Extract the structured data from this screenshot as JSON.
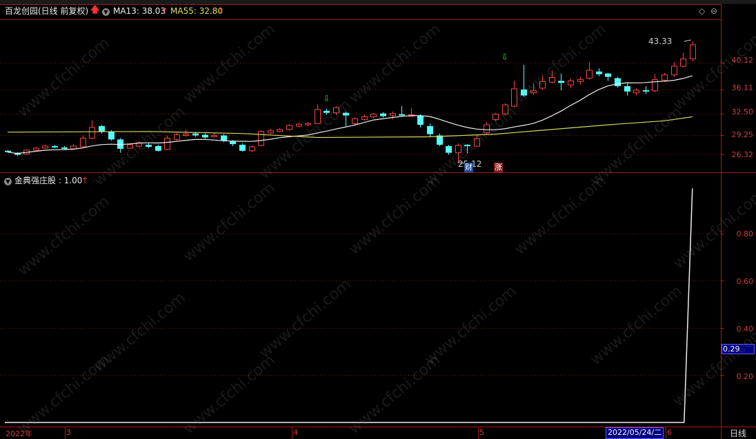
{
  "top_menu": [],
  "top_right_menu": [
    "",
    "",
    "",
    "",
    "",
    ""
  ],
  "price_panel": {
    "title": "百龙创园(日线 前复权)",
    "ma13_label": "MA13: 38.03",
    "ma55_label": "MA55: 32.80",
    "arrow": "↑",
    "high_label": "43.33",
    "low_label": "25.12",
    "marker_cai": "财",
    "marker_zhang": "涨",
    "y_ticks": [
      "40.12",
      "36.11",
      "32.50",
      "29.25",
      "26.32"
    ]
  },
  "indicator_panel": {
    "title": "金典强庄股 : 1.00",
    "arrow": "↑",
    "y_ticks": [
      "0.80",
      "0.60",
      "0.40",
      "0.20"
    ],
    "current_value": "0.29",
    "values_note": "flat 0 then spike to ~0.99 on last bar"
  },
  "date_axis": {
    "labels": [
      "2022年",
      "3",
      "4",
      "5",
      "6"
    ],
    "highlight": "2022/05/24/二",
    "period": "日线"
  },
  "watermark": "www.cfchi.com",
  "colors": {
    "up": "#ff4444",
    "down": "#54ffff",
    "ma13": "#f0f0f0",
    "ma55": "#d8d860",
    "grid": "#7a1a1a",
    "axis": "#a01c1c"
  },
  "candles": [
    [
      26.9,
      26.7,
      27.0,
      26.6
    ],
    [
      26.6,
      26.3,
      26.7,
      26.1
    ],
    [
      26.4,
      27.0,
      27.1,
      26.3
    ],
    [
      27.0,
      27.3,
      27.5,
      26.9
    ],
    [
      27.3,
      27.6,
      27.8,
      27.2
    ],
    [
      27.6,
      27.4,
      27.8,
      27.3
    ],
    [
      27.4,
      27.2,
      27.6,
      27.1
    ],
    [
      27.2,
      27.6,
      27.9,
      27.1
    ],
    [
      27.5,
      28.8,
      29.2,
      27.4
    ],
    [
      28.8,
      30.4,
      31.5,
      28.6
    ],
    [
      30.6,
      29.8,
      30.8,
      29.5
    ],
    [
      29.8,
      28.6,
      30.0,
      28.4
    ],
    [
      28.6,
      27.2,
      28.8,
      26.6
    ],
    [
      27.3,
      27.8,
      28.0,
      27.2
    ],
    [
      27.6,
      28.1,
      28.3,
      27.4
    ],
    [
      27.8,
      27.5,
      28.0,
      27.3
    ],
    [
      27.6,
      26.9,
      27.8,
      26.8
    ],
    [
      27.1,
      28.8,
      29.2,
      27.0
    ],
    [
      28.6,
      29.3,
      29.6,
      28.4
    ],
    [
      29.2,
      29.4,
      30.1,
      29.0
    ],
    [
      29.5,
      29.2,
      29.7,
      29.0
    ],
    [
      29.3,
      28.9,
      29.5,
      28.7
    ],
    [
      29.0,
      29.2,
      29.5,
      28.9
    ],
    [
      29.2,
      28.4,
      29.4,
      28.2
    ],
    [
      28.3,
      27.9,
      28.5,
      27.6
    ],
    [
      27.8,
      26.9,
      28.0,
      26.8
    ],
    [
      26.9,
      27.5,
      27.7,
      26.7
    ],
    [
      27.7,
      29.8,
      30.0,
      27.6
    ],
    [
      29.6,
      29.9,
      30.2,
      29.4
    ],
    [
      29.8,
      30.1,
      30.3,
      29.7
    ],
    [
      30.1,
      30.7,
      30.9,
      29.9
    ],
    [
      30.6,
      30.9,
      31.1,
      30.4
    ],
    [
      30.8,
      31.0,
      31.2,
      30.6
    ],
    [
      31.0,
      33.1,
      33.9,
      30.9
    ],
    [
      32.9,
      32.6,
      33.2,
      32.3
    ],
    [
      32.6,
      33.4,
      33.6,
      32.3
    ],
    [
      32.6,
      32.2,
      32.8,
      30.6
    ],
    [
      31.0,
      31.7,
      31.9,
      30.8
    ],
    [
      31.6,
      32.0,
      32.3,
      31.4
    ],
    [
      32.0,
      32.4,
      32.6,
      31.8
    ],
    [
      32.5,
      32.1,
      32.7,
      31.9
    ],
    [
      32.2,
      32.5,
      32.8,
      31.6
    ],
    [
      32.4,
      32.2,
      33.6,
      32.1
    ],
    [
      32.1,
      32.3,
      33.3,
      32.0
    ],
    [
      32.2,
      30.8,
      32.4,
      30.4
    ],
    [
      30.6,
      29.4,
      31.0,
      29.0
    ],
    [
      29.2,
      27.8,
      29.5,
      27.6
    ],
    [
      27.6,
      26.6,
      27.8,
      26.3
    ],
    [
      26.6,
      27.7,
      28.0,
      25.12
    ],
    [
      27.8,
      27.6,
      27.9,
      26.5
    ],
    [
      27.6,
      28.7,
      29.2,
      27.5
    ],
    [
      29.6,
      30.8,
      31.2,
      29.4
    ],
    [
      31.6,
      32.4,
      32.6,
      31.3
    ],
    [
      32.4,
      33.8,
      34.0,
      32.2
    ],
    [
      33.6,
      36.2,
      37.4,
      33.4
    ],
    [
      36.1,
      35.2,
      39.8,
      35.0
    ],
    [
      35.6,
      35.9,
      37.0,
      35.3
    ],
    [
      36.3,
      37.3,
      38.2,
      36.0
    ],
    [
      37.2,
      37.9,
      39.0,
      37.0
    ],
    [
      37.4,
      37.1,
      38.5,
      36.0
    ],
    [
      36.8,
      37.4,
      37.8,
      36.3
    ],
    [
      37.3,
      37.6,
      38.0,
      36.8
    ],
    [
      37.8,
      39.0,
      40.2,
      37.6
    ],
    [
      38.8,
      38.4,
      39.3,
      38.1
    ],
    [
      38.5,
      38.0,
      38.6,
      37.4
    ],
    [
      37.8,
      36.6,
      38.0,
      36.4
    ],
    [
      36.6,
      35.8,
      37.0,
      35.2
    ],
    [
      35.6,
      36.0,
      36.3,
      35.2
    ],
    [
      36.0,
      35.8,
      36.6,
      35.4
    ],
    [
      35.9,
      37.6,
      38.4,
      35.7
    ],
    [
      37.5,
      38.3,
      38.6,
      37.2
    ],
    [
      38.3,
      39.6,
      40.2,
      38.0
    ],
    [
      39.6,
      40.7,
      41.6,
      39.4
    ],
    [
      40.7,
      42.8,
      43.33,
      40.3
    ]
  ]
}
